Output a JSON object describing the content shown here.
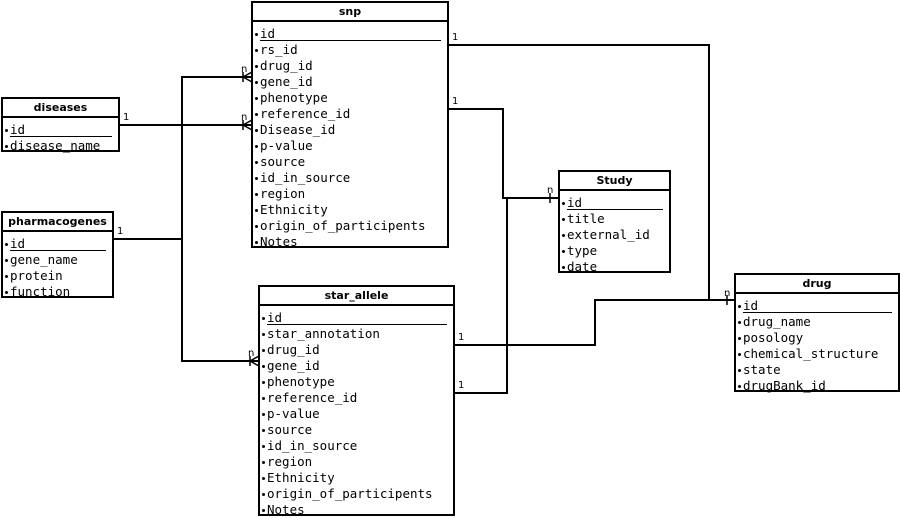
{
  "entities": {
    "snp": {
      "name": "snp",
      "fields": [
        "id",
        "rs_id",
        "drug_id",
        "gene_id",
        "phenotype",
        "reference_id",
        "Disease_id",
        "p-value",
        "source",
        "id_in_source",
        "region",
        "Ethnicity",
        "origin_of_participents",
        "Notes"
      ]
    },
    "diseases": {
      "name": "diseases",
      "fields": [
        "id",
        "disease_name"
      ]
    },
    "pharmacogenes": {
      "name": "pharmacogenes",
      "fields": [
        "id",
        "gene_name",
        "protein",
        "function"
      ]
    },
    "study": {
      "name": "Study",
      "fields": [
        "id",
        "title",
        "external_id",
        "type",
        "date"
      ]
    },
    "star_allele": {
      "name": "star_allele",
      "fields": [
        "id",
        "star_annotation",
        "drug_id",
        "gene_id",
        "phenotype",
        "reference_id",
        "p-value",
        "source",
        "id_in_source",
        "region",
        "Ethnicity",
        "origin_of_participents",
        "Notes"
      ]
    },
    "drug": {
      "name": "drug",
      "fields": [
        "id",
        "drug_name",
        "posology",
        "chemical_structure",
        "state",
        "drugBank_id"
      ]
    }
  },
  "relationships": [
    {
      "from": "snp",
      "to": "drug",
      "from_cardinality": "1",
      "to_cardinality": "n"
    },
    {
      "from": "snp",
      "to": "Study",
      "from_cardinality": "1",
      "to_cardinality": "n"
    },
    {
      "from": "diseases",
      "to": "snp",
      "from_cardinality": "1",
      "to_cardinality": "n"
    },
    {
      "from": "pharmacogenes",
      "to": "snp",
      "from_cardinality": "1",
      "to_cardinality": "n"
    },
    {
      "from": "pharmacogenes",
      "to": "star_allele",
      "from_cardinality": "1",
      "to_cardinality": "n"
    },
    {
      "from": "star_allele",
      "to": "drug",
      "from_cardinality": "1",
      "to_cardinality": "n"
    },
    {
      "from": "star_allele",
      "to": "Study",
      "from_cardinality": "1",
      "to_cardinality": "n"
    }
  ]
}
